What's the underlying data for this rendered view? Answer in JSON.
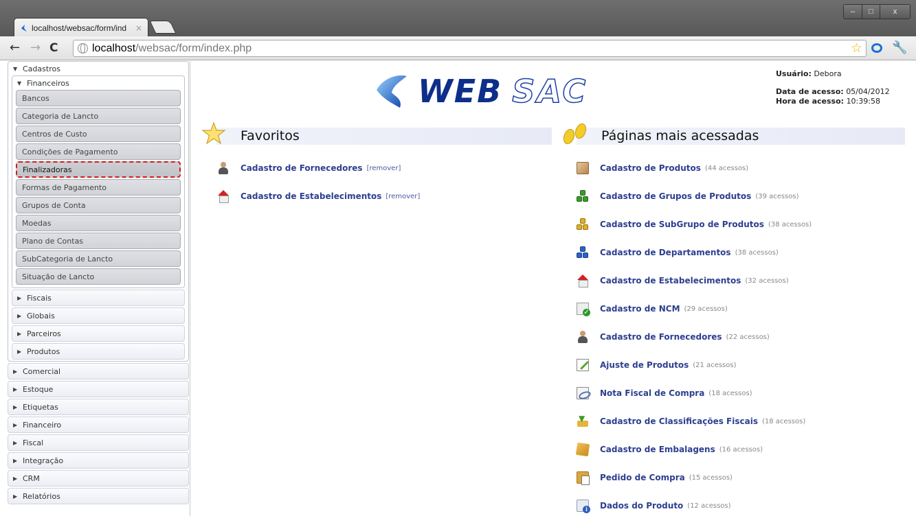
{
  "browser": {
    "tab_title": "localhost/websac/form/ind",
    "tab_close": "×",
    "url_host": "localhost",
    "url_path": "/websac/form/index.php",
    "win_min": "–",
    "win_max": "□",
    "win_close": "x",
    "back": "←",
    "forward": "→",
    "reload": "C"
  },
  "sidebar": {
    "cadastros": "Cadastros",
    "financeiros": "Financeiros",
    "financeiros_items": [
      "Bancos",
      "Categoria de Lancto",
      "Centros de Custo",
      "Condições de Pagamento",
      "Finalizadoras",
      "Formas de Pagamento",
      "Grupos de Conta",
      "Moedas",
      "Plano de Contas",
      "SubCategoria de Lancto",
      "Situação de Lancto"
    ],
    "active_item": "Finalizadoras",
    "cadastros_sub": [
      "Fiscais",
      "Globais",
      "Parceiros",
      "Produtos"
    ],
    "top_level": [
      "Comercial",
      "Estoque",
      "Etiquetas",
      "Financeiro",
      "Fiscal",
      "Integração",
      "CRM",
      "Relatórios"
    ]
  },
  "header": {
    "logo_web": "WEB",
    "logo_sac": "SAC",
    "user_label": "Usuário:",
    "user_value": "Debora",
    "date_label": "Data de acesso:",
    "date_value": "05/04/2012",
    "time_label": "Hora de acesso:",
    "time_value": "10:39:58"
  },
  "favorites": {
    "title": "Favoritos",
    "remove_label": "[remover]",
    "items": [
      {
        "label": "Cadastro de Fornecedores",
        "icon": "user-icon"
      },
      {
        "label": "Cadastro de Estabelecimentos",
        "icon": "house-icon"
      }
    ]
  },
  "most_accessed": {
    "title": "Páginas mais acessadas",
    "items": [
      {
        "label": "Cadastro de Produtos",
        "count": "(44 acessos)",
        "icon": "box-icon"
      },
      {
        "label": "Cadastro de Grupos de Produtos",
        "count": "(39 acessos)",
        "icon": "green-cubes-icon"
      },
      {
        "label": "Cadastro de SubGrupo de Produtos",
        "count": "(38 acessos)",
        "icon": "yellow-cubes-icon"
      },
      {
        "label": "Cadastro de Departamentos",
        "count": "(38 acessos)",
        "icon": "blue-cubes-icon"
      },
      {
        "label": "Cadastro de Estabelecimentos",
        "count": "(32 acessos)",
        "icon": "house-icon"
      },
      {
        "label": "Cadastro de NCM",
        "count": "(29 acessos)",
        "icon": "note-check-icon"
      },
      {
        "label": "Cadastro de Fornecedores",
        "count": "(22 acessos)",
        "icon": "user-icon"
      },
      {
        "label": "Ajuste de Produtos",
        "count": "(21 acessos)",
        "icon": "pencil-icon"
      },
      {
        "label": "Nota Fiscal de Compra",
        "count": "(18 acessos)",
        "icon": "document-icon"
      },
      {
        "label": "Cadastro de Classificações Fiscais",
        "count": "(18 acessos)",
        "icon": "download-icon"
      },
      {
        "label": "Cadastro de Embalagens",
        "count": "(16 acessos)",
        "icon": "package-icon"
      },
      {
        "label": "Pedido de Compra",
        "count": "(15 acessos)",
        "icon": "order-icon"
      },
      {
        "label": "Dados do Produto",
        "count": "(12 acessos)",
        "icon": "product-info-icon"
      }
    ]
  }
}
